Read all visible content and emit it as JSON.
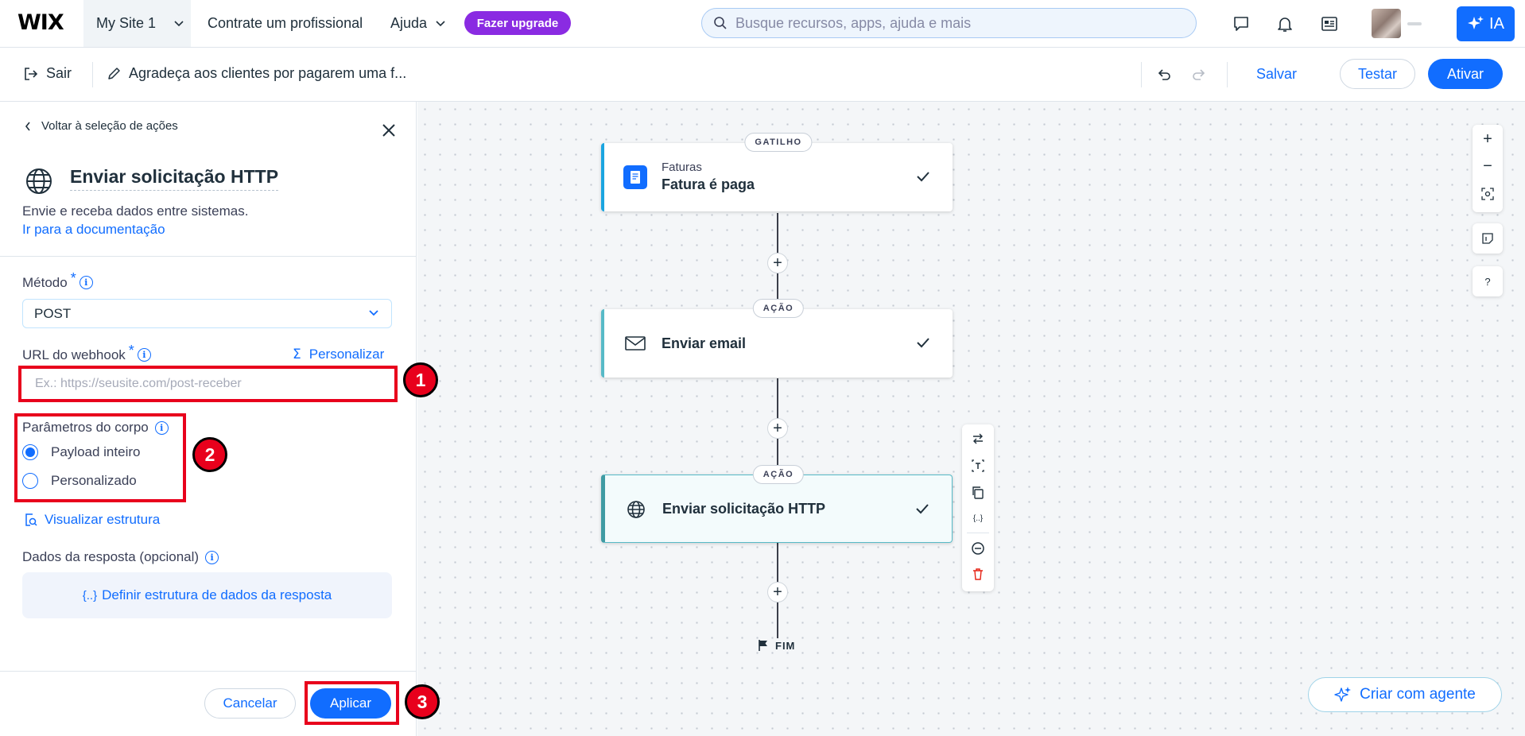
{
  "topbar": {
    "logo": "WIX",
    "site_name": "My Site 1",
    "hire_pro": "Contrate um profissional",
    "help": "Ajuda",
    "upgrade": "Fazer upgrade",
    "search_placeholder": "Busque recursos, apps, ajuda e mais",
    "ia": "IA"
  },
  "subbar": {
    "exit": "Sair",
    "flow_name": "Agradeça aos clientes por pagarem uma f...",
    "save": "Salvar",
    "test": "Testar",
    "activate": "Ativar"
  },
  "panel": {
    "back": "Voltar à seleção de ações",
    "title": "Enviar solicitação HTTP",
    "description": "Envie e receba dados entre sistemas.",
    "doc_link": "Ir para a documentação",
    "method_label": "Método",
    "method_value": "POST",
    "webhook_label": "URL do webhook",
    "customize": "Personalizar",
    "webhook_placeholder": "Ex.: https://seusite.com/post-receber",
    "body_params_label": "Parâmetros do corpo",
    "radio_full": "Payload inteiro",
    "radio_custom": "Personalizado",
    "view_structure": "Visualizar estrutura",
    "response_label": "Dados da resposta (opcional)",
    "response_define": "Definir estrutura de dados da resposta",
    "cancel": "Cancelar",
    "apply": "Aplicar"
  },
  "annotations": [
    "1",
    "2",
    "3"
  ],
  "canvas": {
    "trigger": {
      "pill": "GATILHO",
      "sub": "Faturas",
      "title": "Fatura é paga"
    },
    "action1": {
      "pill": "AÇÃO",
      "title": "Enviar email"
    },
    "action2": {
      "pill": "AÇÃO",
      "title": "Enviar solicitação HTTP"
    },
    "end": "FIM",
    "help": "?",
    "create_agent": "Criar com agente"
  },
  "colors": {
    "accent": "#116dff",
    "upgrade": "#8a2be2",
    "annotation": "#e8001c"
  },
  "icons": [
    "search-icon",
    "chat-icon",
    "bell-icon",
    "news-icon",
    "sparkle-icon",
    "exit-icon",
    "pencil-icon",
    "undo-icon",
    "redo-icon",
    "globe-icon",
    "close-icon",
    "info-icon",
    "chevron-down-icon",
    "sigma-icon",
    "magnify-doc-icon",
    "braces-icon",
    "invoice-icon",
    "mail-icon",
    "check-icon",
    "plus-icon",
    "flag-icon",
    "zoom-in-icon",
    "zoom-out-icon",
    "fit-icon",
    "note-icon",
    "swap-icon",
    "text-icon",
    "copy-icon",
    "variable-icon",
    "disable-icon",
    "trash-icon"
  ]
}
